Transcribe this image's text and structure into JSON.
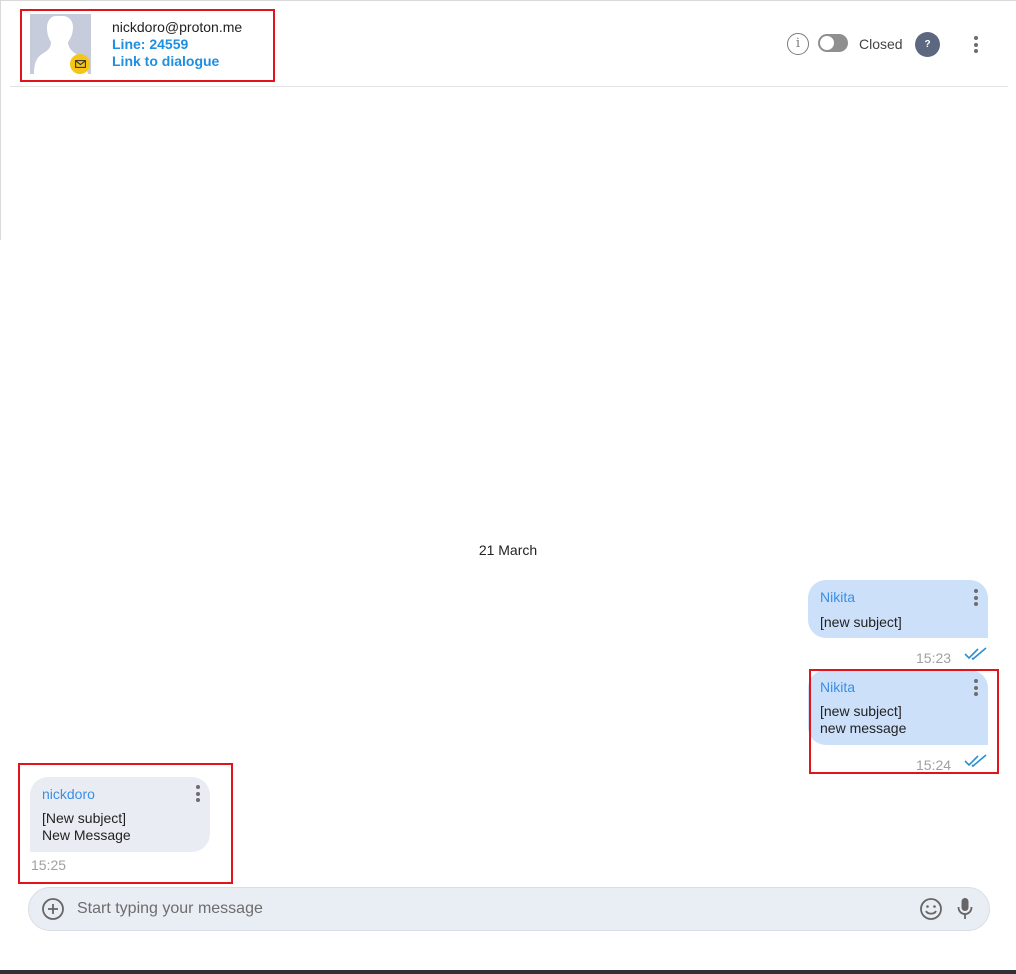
{
  "header": {
    "contact_email": "nickdoro@proton.me",
    "line_label": "Line: 24559",
    "link_label": "Link to dialogue",
    "status_label": "Closed",
    "help_label": "?",
    "info_label": "i",
    "toggle_state": "off"
  },
  "conversation": {
    "date_separator": "21 March",
    "messages": [
      {
        "sender": "Nikita",
        "text": "[new subject]",
        "time": "15:23",
        "direction": "outgoing",
        "status": "read"
      },
      {
        "sender": "Nikita",
        "text": "[new subject]\nnew message",
        "time": "15:24",
        "direction": "outgoing",
        "status": "read"
      },
      {
        "sender": "nickdoro",
        "text": "[New subject]\nNew Message",
        "time": "15:25",
        "direction": "incoming"
      }
    ]
  },
  "composer": {
    "placeholder": "Start typing your message",
    "value": ""
  },
  "colors": {
    "accent": "#1f8fe0",
    "highlight": "#e0141b",
    "outgoing_bubble": "#cce0fa",
    "incoming_bubble": "#e9edf3",
    "badge": "#f5c518"
  },
  "icons": [
    "mail-icon",
    "info-icon",
    "help-icon",
    "more-vertical-icon",
    "double-check-icon",
    "plus-circle-icon",
    "emoji-icon",
    "microphone-icon"
  ]
}
